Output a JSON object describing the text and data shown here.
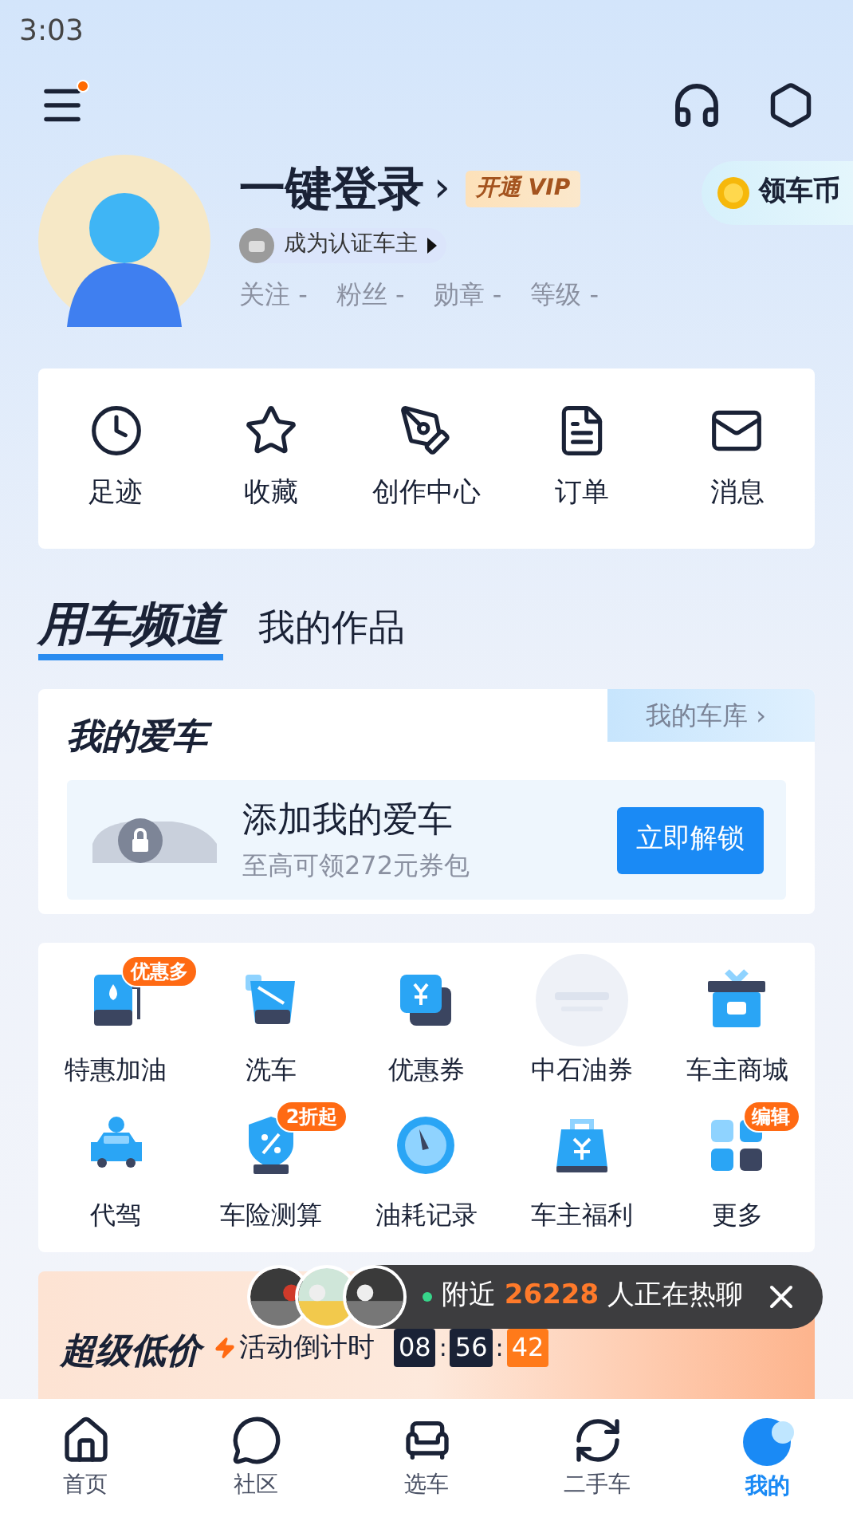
{
  "status_bar": {
    "time": "3:03"
  },
  "toolbar": {
    "menu_badge": true
  },
  "profile": {
    "name": "一键登录",
    "chevron": "›",
    "vip": "开通 VIP",
    "coin_button": "领车币",
    "verify": "成为认证车主",
    "stats": [
      {
        "label": "关注",
        "value": "-"
      },
      {
        "label": "粉丝",
        "value": "-"
      },
      {
        "label": "勋章",
        "value": "-"
      },
      {
        "label": "等级",
        "value": "-"
      }
    ]
  },
  "quick_actions": [
    {
      "label": "足迹"
    },
    {
      "label": "收藏"
    },
    {
      "label": "创作中心"
    },
    {
      "label": "订单"
    },
    {
      "label": "消息"
    }
  ],
  "tabs": [
    {
      "label": "用车频道",
      "selected": true
    },
    {
      "label": "我的作品",
      "selected": false
    }
  ],
  "my_car": {
    "title": "我的爱车",
    "garage_link": "我的车库 ›",
    "add_title": "添加我的爱车",
    "add_subtitle": "至高可领272元券包",
    "unlock_button": "立即解锁"
  },
  "services": [
    {
      "label": "特惠加油",
      "badge": "优惠多"
    },
    {
      "label": "洗车"
    },
    {
      "label": "优惠券"
    },
    {
      "label": "中石油券"
    },
    {
      "label": "车主商城"
    },
    {
      "label": "代驾"
    },
    {
      "label": "车险测算",
      "badge": "2折起"
    },
    {
      "label": "油耗记录"
    },
    {
      "label": "车主福利"
    },
    {
      "label": "更多",
      "badge": "编辑"
    }
  ],
  "chat_bar": {
    "prefix": "附近",
    "count": "26228",
    "suffix": "人正在热聊"
  },
  "promo": {
    "title": "超级低价",
    "countdown_label": "活动倒计时",
    "countdown": [
      {
        "value": "08",
        "highlighted": false
      },
      {
        "value": "56",
        "highlighted": false
      },
      {
        "value": "42",
        "highlighted": true
      }
    ],
    "separator": ":"
  },
  "bottom_nav": [
    {
      "label": "首页",
      "selected": false
    },
    {
      "label": "社区",
      "selected": false
    },
    {
      "label": "选车",
      "selected": false
    },
    {
      "label": "二手车",
      "selected": false
    },
    {
      "label": "我的",
      "selected": true
    }
  ]
}
